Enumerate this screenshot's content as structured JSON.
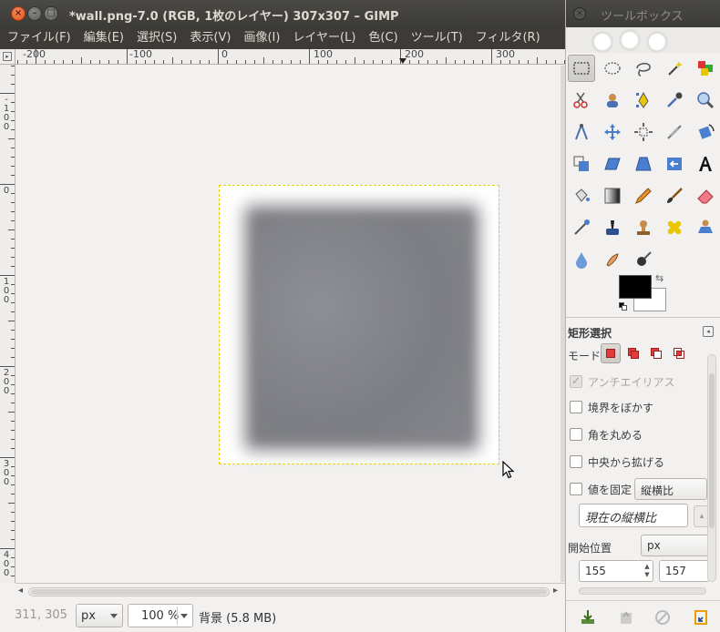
{
  "window": {
    "title": "*wall.png-7.0 (RGB, 1枚のレイヤー) 307x307 – GIMP",
    "close_glyph": "×",
    "minimize_glyph": "–",
    "maximize_glyph": "□"
  },
  "menubar": {
    "items": [
      "ファイル(F)",
      "編集(E)",
      "選択(S)",
      "表示(V)",
      "画像(I)",
      "レイヤー(L)",
      "色(C)",
      "ツール(T)",
      "フィルタ(R)"
    ]
  },
  "rulers": {
    "horizontal_labels": [
      "-200",
      "-100",
      "0",
      "100",
      "200",
      "300"
    ],
    "vertical_labels": [
      "-100",
      "0",
      "100",
      "200",
      "300",
      "400"
    ]
  },
  "canvas": {
    "image_name": "wall.png",
    "image_size": "307x307"
  },
  "statusbar": {
    "coords": "311, 305",
    "unit": "px",
    "zoom": "100 %",
    "layer_info": "背景 (5.8 MB)"
  },
  "toolbox": {
    "title": "ツールボックス",
    "close_glyph": "×",
    "tools": [
      "rect-select",
      "ellipse-select",
      "free-select",
      "fuzzy-select",
      "color-select",
      "scissors-select",
      "foreground-select",
      "paths",
      "color-picker",
      "zoom",
      "measure",
      "move",
      "align",
      "crop",
      "rotate",
      "scale",
      "shear",
      "perspective",
      "flip",
      "text",
      "bucket-fill",
      "blend",
      "pencil",
      "paintbrush",
      "eraser",
      "airbrush",
      "ink",
      "clone",
      "heal",
      "perspective-clone",
      "blur-sharpen",
      "smudge",
      "dodge-burn"
    ],
    "foreground_color": "#000000",
    "background_color": "#ffffff",
    "swap_glyph": "⇆"
  },
  "tool_options": {
    "title": "矩形選択",
    "mode_label": "モード:",
    "antialias_label": "アンチエイリアス",
    "feather_label": "境界をぼかす",
    "rounded_label": "角を丸める",
    "expand_center_label": "中央から拡げる",
    "fixed_label": "値を固定",
    "fixed_value": "縦横比",
    "aspect_value": "現在の縦横比",
    "position_label": "開始位置",
    "position_unit": "px",
    "position_x": "155",
    "position_y": "157"
  }
}
